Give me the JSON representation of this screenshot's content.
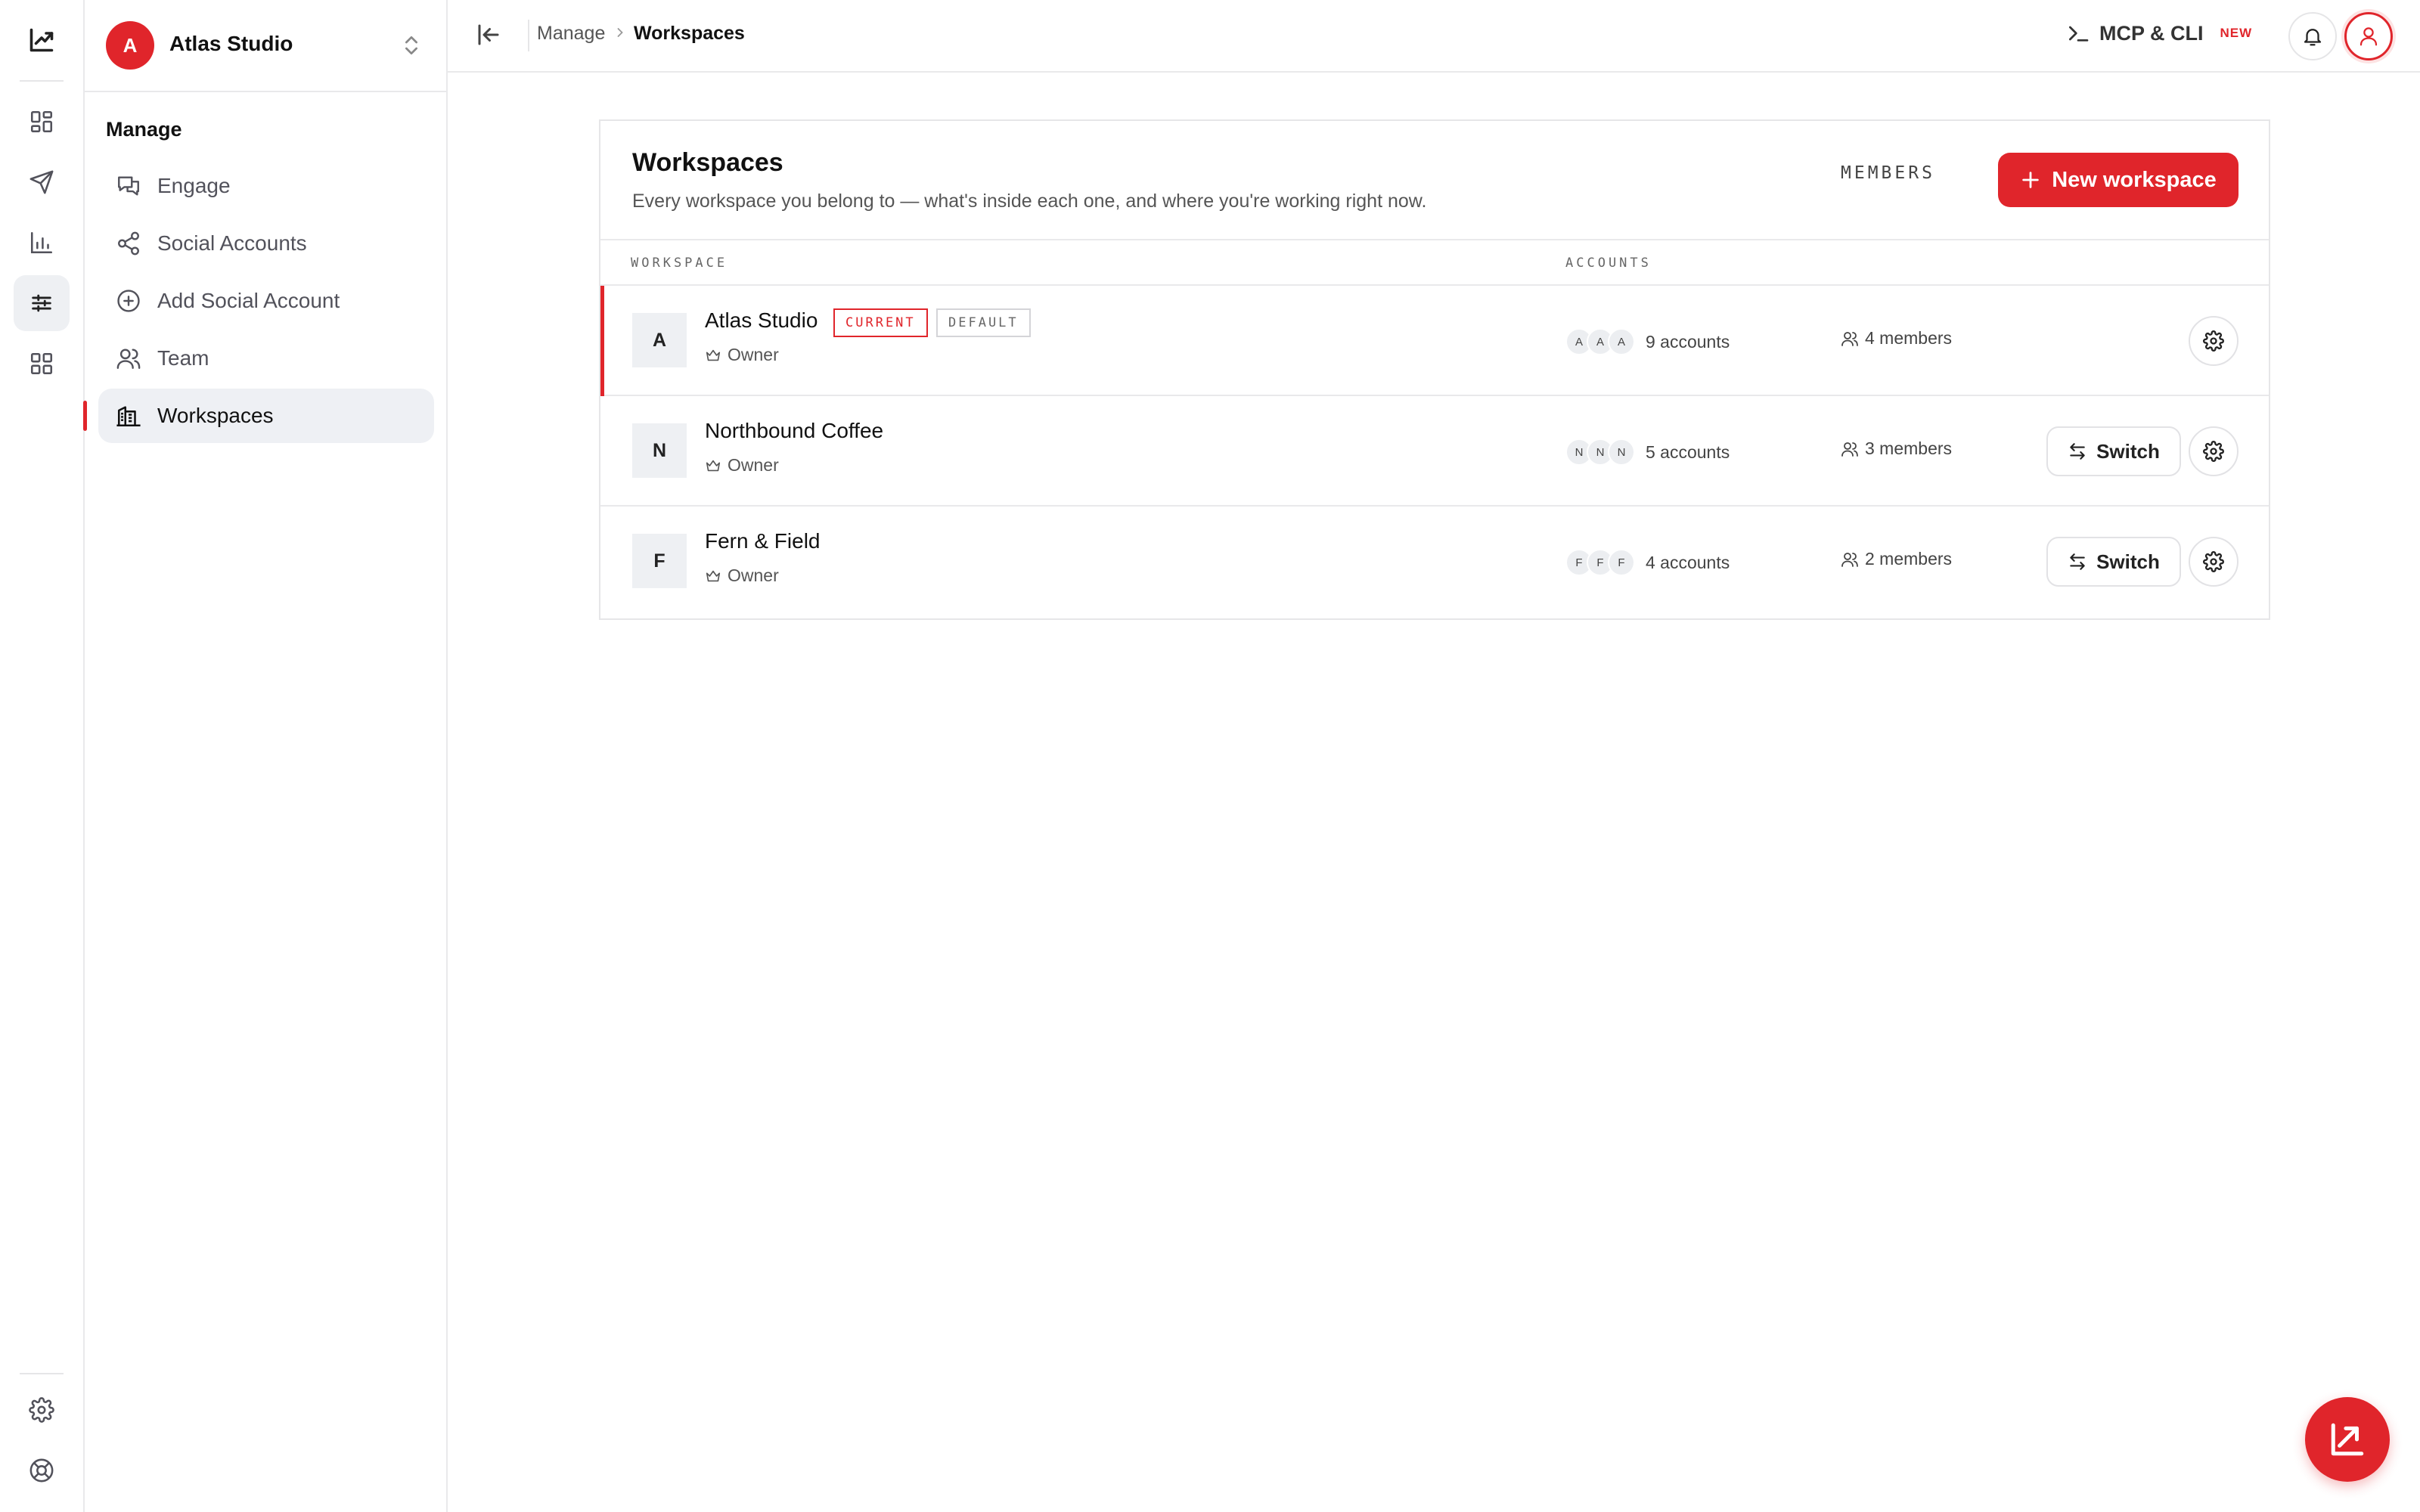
{
  "workspace_switcher": {
    "avatar_letter": "A",
    "name": "Atlas Studio"
  },
  "rail": {
    "items": [
      {
        "icon": "logo-chart-icon"
      },
      {
        "icon": "dashboard-icon"
      },
      {
        "icon": "send-icon"
      },
      {
        "icon": "analytics-icon"
      },
      {
        "icon": "sliders-icon",
        "active": true
      },
      {
        "icon": "apps-icon"
      },
      {
        "icon": "settings-icon"
      },
      {
        "icon": "help-lifebuoy-icon"
      }
    ]
  },
  "sidebar": {
    "heading": "Manage",
    "items": [
      {
        "label": "Engage",
        "icon": "chat-bubbles-icon"
      },
      {
        "label": "Social Accounts",
        "icon": "share-nodes-icon"
      },
      {
        "label": "Add Social Account",
        "icon": "plus-circle-icon"
      },
      {
        "label": "Team",
        "icon": "users-icon"
      },
      {
        "label": "Workspaces",
        "icon": "building-icon",
        "active": true
      }
    ]
  },
  "topbar": {
    "breadcrumb": [
      "Manage",
      "Workspaces"
    ],
    "mcp_label": "MCP & CLI",
    "mcp_badge": "NEW"
  },
  "card": {
    "title": "Workspaces",
    "subtitle": "Every workspace you belong to — what's inside each one, and where you're working right now.",
    "new_button": "New workspace",
    "columns": [
      "WORKSPACE",
      "ACCOUNTS",
      "MEMBERS"
    ],
    "rows": [
      {
        "letter": "A",
        "name": "Atlas Studio",
        "role": "Owner",
        "tags": [
          "CURRENT",
          "DEFAULT"
        ],
        "account_avatars": [
          "A",
          "A",
          "A"
        ],
        "accounts": "9 accounts",
        "members": "4 members",
        "current": true
      },
      {
        "letter": "N",
        "name": "Northbound Coffee",
        "role": "Owner",
        "tags": [],
        "account_avatars": [
          "N",
          "N",
          "N"
        ],
        "accounts": "5 accounts",
        "members": "3 members",
        "switch_label": "Switch"
      },
      {
        "letter": "F",
        "name": "Fern & Field",
        "role": "Owner",
        "tags": [],
        "account_avatars": [
          "F",
          "F",
          "F"
        ],
        "accounts": "4 accounts",
        "members": "2 members",
        "switch_label": "Switch"
      }
    ]
  },
  "colors": {
    "accent": "#e0252b",
    "border": "#e9e9eb",
    "muted_bg": "#eef0f3"
  }
}
